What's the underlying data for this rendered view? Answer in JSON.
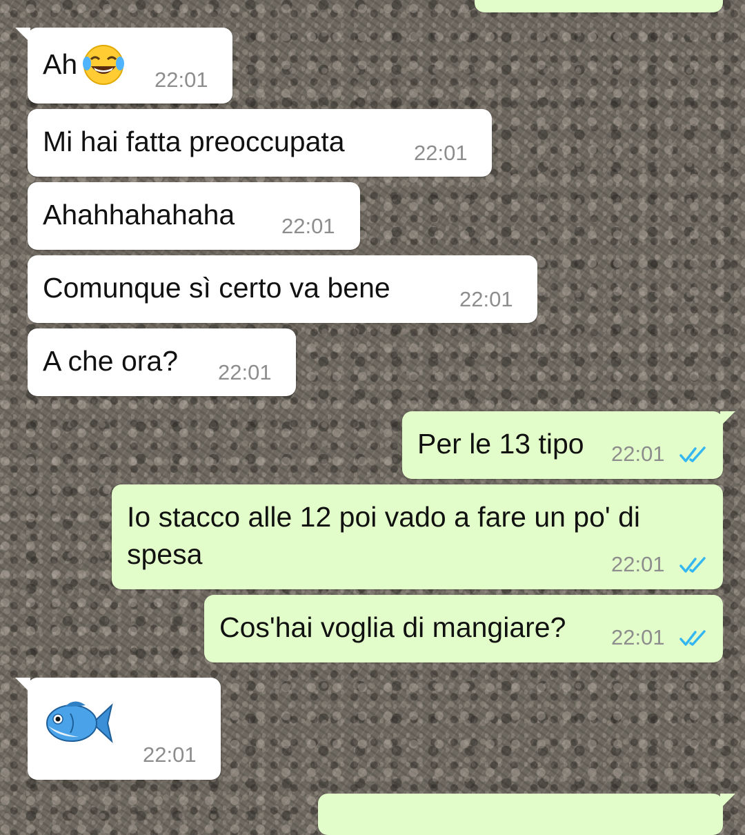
{
  "colors": {
    "incoming_bubble": "#ffffff",
    "outgoing_bubble": "#e2fdc9",
    "timestamp": "#8d8d8d",
    "read_ticks": "#34b7f1"
  },
  "messages": [
    {
      "direction": "incoming",
      "text": "Ah",
      "emoji": "face-with-tears-of-joy",
      "time": "22:01"
    },
    {
      "direction": "incoming",
      "text": "Mi hai fatta preoccupata",
      "time": "22:01"
    },
    {
      "direction": "incoming",
      "text": "Ahahhahahaha",
      "time": "22:01"
    },
    {
      "direction": "incoming",
      "text": "Comunque sì certo va bene",
      "time": "22:01"
    },
    {
      "direction": "incoming",
      "text": "A che ora?",
      "time": "22:01"
    },
    {
      "direction": "outgoing",
      "text": "Per le 13 tipo",
      "time": "22:01",
      "status": "read"
    },
    {
      "direction": "outgoing",
      "text": "Io stacco alle 12 poi vado a fare un po' di spesa",
      "time": "22:01",
      "status": "read"
    },
    {
      "direction": "outgoing",
      "text": "Cos'hai voglia di mangiare?",
      "time": "22:01",
      "status": "read"
    },
    {
      "direction": "incoming",
      "emoji": "fish",
      "time": "22:01"
    }
  ]
}
